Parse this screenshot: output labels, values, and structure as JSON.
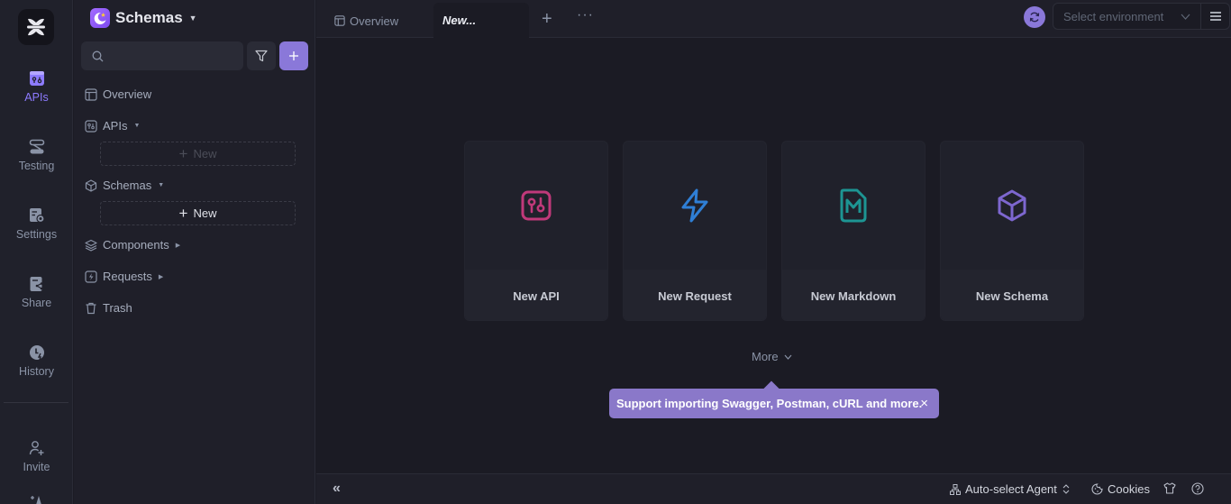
{
  "rail": {
    "items": [
      {
        "label": "APIs",
        "icon": "api-icon",
        "active": true
      },
      {
        "label": "Testing",
        "icon": "testing-icon"
      },
      {
        "label": "Settings",
        "icon": "settings-icon"
      },
      {
        "label": "Share",
        "icon": "share-icon"
      },
      {
        "label": "History",
        "icon": "history-icon"
      },
      {
        "label": "Invite",
        "icon": "invite-icon"
      }
    ]
  },
  "sidebar": {
    "project_name": "Schemas",
    "search": {
      "placeholder": "",
      "value": ""
    },
    "nav": [
      {
        "label": "Overview",
        "icon": "overview-icon"
      },
      {
        "label": "APIs",
        "icon": "api-icon",
        "caret": "▼"
      },
      {
        "label": "Schemas",
        "icon": "cube-icon",
        "caret": "▼"
      },
      {
        "label": "Components",
        "icon": "layers-icon",
        "caret": "▶"
      },
      {
        "label": "Requests",
        "icon": "bolt-icon",
        "caret": "▶"
      },
      {
        "label": "Trash",
        "icon": "trash-icon"
      }
    ],
    "new_api_label": "New",
    "new_schema_label": "New"
  },
  "topbar": {
    "tabs": [
      {
        "label": "Overview",
        "icon": "overview-icon"
      },
      {
        "label": "New...",
        "active": true
      }
    ],
    "add_tab": "+",
    "more_tabs": "···",
    "environment": {
      "placeholder": "Select environment",
      "value": ""
    }
  },
  "main": {
    "cards": [
      {
        "label": "New API",
        "icon": "api-icon",
        "color": "#c0397a"
      },
      {
        "label": "New Request",
        "icon": "bolt-icon",
        "color": "#2f7fd6"
      },
      {
        "label": "New Markdown",
        "icon": "markdown-icon",
        "color": "#1d9593"
      },
      {
        "label": "New Schema",
        "icon": "cube-icon",
        "color": "#7d67cf"
      }
    ],
    "more_label": "More",
    "tooltip": "Support importing Swagger, Postman, cURL and more.",
    "tooltip_close": "×"
  },
  "footer": {
    "collapse": "«",
    "agent": "Auto-select Agent",
    "cookies": "Cookies"
  },
  "colors": {
    "accent": "#8a78d9",
    "background": "#1b1b24",
    "panel": "#1f1f29"
  }
}
